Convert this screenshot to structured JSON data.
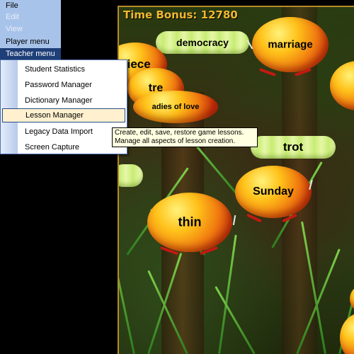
{
  "menubar": {
    "items": [
      {
        "label": "File"
      },
      {
        "label": "Edit"
      },
      {
        "label": "View"
      },
      {
        "label": "Player menu"
      },
      {
        "label": "Teacher menu"
      }
    ]
  },
  "teacher_menu": {
    "items": [
      {
        "label": "Student Statistics"
      },
      {
        "label": "Password Manager"
      },
      {
        "label": "Dictionary Manager"
      },
      {
        "label": "Lesson Manager"
      },
      {
        "label": "Legacy Data Import"
      },
      {
        "label": "Screen Capture"
      }
    ],
    "highlighted": "Lesson Manager"
  },
  "tooltip": {
    "line1": "Create, edit, save, restore game lessons.",
    "line2": "Manage all aspects of lesson creation."
  },
  "game": {
    "time_bonus": "Time Bonus: 12780",
    "words": {
      "piece": "piece",
      "tre": "tre",
      "democracy": "democracy",
      "marriage": "marriage",
      "ladies_of_love": "adies of love",
      "trot": "trot",
      "sunday": "Sunday",
      "thin": "thin"
    }
  },
  "colors": {
    "menubar_bg": "#a8c3ea",
    "menu_active_bg": "#1f3f78",
    "hover_bg": "#fff1cf",
    "time_bonus_text": "#f0b830",
    "beetle_orange": "#f07a10",
    "caterpillar_green": "#c7ec74"
  }
}
